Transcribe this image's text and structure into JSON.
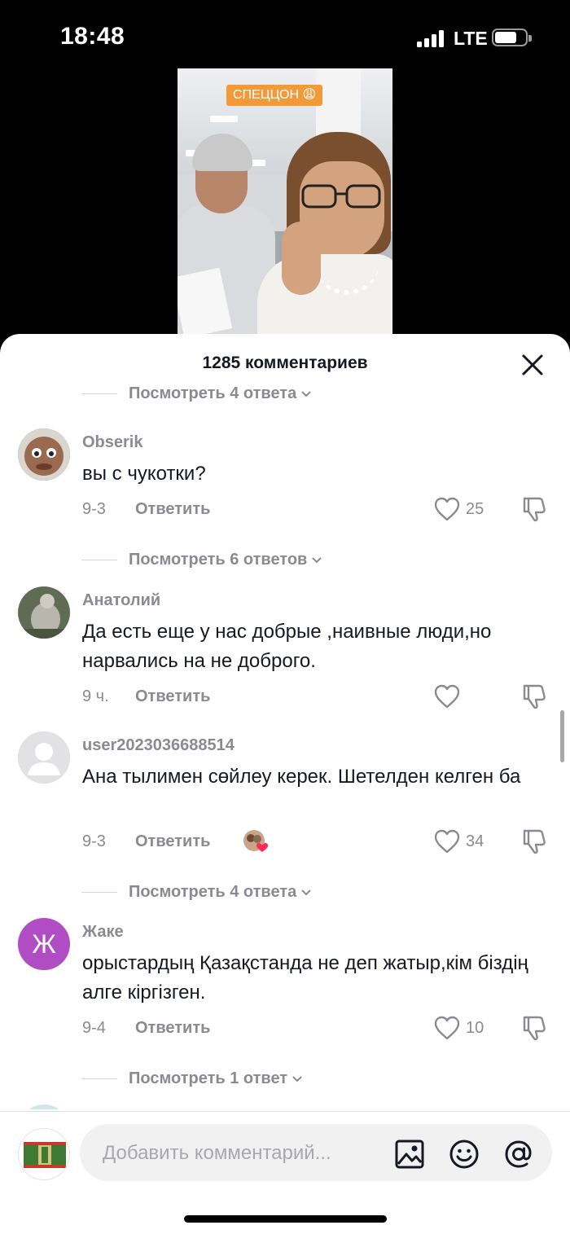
{
  "status_bar": {
    "time": "18:48",
    "network": "LTE"
  },
  "video": {
    "tag": "СПЕЦЦОН 😩"
  },
  "sheet": {
    "title": "1285 комментариев"
  },
  "top_replies": "Посмотреть 4 ответа",
  "comments": [
    {
      "username": "Obserik",
      "text": "вы с чукотки?",
      "date": "9-3",
      "reply_label": "Ответить",
      "likes": "25",
      "replies": "Посмотреть 6 ответов"
    },
    {
      "username": "Анатолий",
      "text": "Да есть еще у нас добрые ,наивные люди,но нарвались на не доброго.",
      "date": "9 ч.",
      "reply_label": "Ответить",
      "likes": ""
    },
    {
      "username": "user2023036688514",
      "text": "Ана тылимен сөйлеу керек. Шетелден келген ба",
      "date": "9-3",
      "reply_label": "Ответить",
      "likes": "34",
      "replies": "Посмотреть 4 ответа"
    },
    {
      "username": "Жаке",
      "avatar_letter": "Ж",
      "text": "орыстардың Қазақстанда не деп жатыр,кім біздің алге кіргізген.",
      "date": "9-4",
      "reply_label": "Ответить",
      "likes": "10",
      "replies": "Посмотреть 1 ответ"
    }
  ],
  "input": {
    "placeholder": "Добавить комментарий..."
  },
  "icons": [
    "close-icon",
    "heart-icon",
    "dislike-icon",
    "chevron-down-icon",
    "image-icon",
    "emoji-icon",
    "mention-icon"
  ],
  "colors": {
    "text": "#161823",
    "muted": "#8a8b91",
    "avatar_purple": "#b04dc5",
    "like_red": "#fe2c55"
  }
}
